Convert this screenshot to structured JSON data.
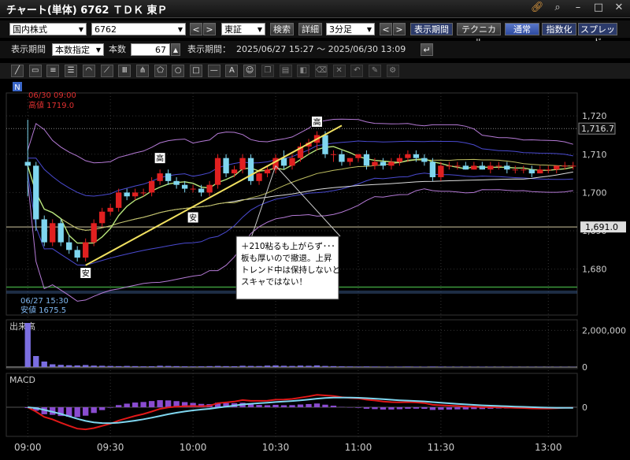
{
  "window": {
    "title": "チャート(単体) 6762 ＴＤＫ 東Ｐ"
  },
  "toolbar1": {
    "market": "国内株式",
    "code": "6762",
    "exchange": "東証",
    "search": "検索",
    "detail": "詳細",
    "interval": "3分足",
    "period_btn": "表示期間",
    "technical_btn": "テクニカル",
    "normal_btn": "通常",
    "index_btn": "指数化",
    "spread_btn": "スプレッド",
    "prev": "<",
    "next": ">"
  },
  "toolbar2": {
    "period_label": "表示期間",
    "mode": "本数指定",
    "count_label": "本数",
    "count": "67",
    "range_label": "表示期間：",
    "range": "2025/06/27 15:27 ～ 2025/06/30 13:09"
  },
  "tools": [
    "line-tool",
    "ruler-tool",
    "hline-tool",
    "channel-tool",
    "arc-tool",
    "fan-tool",
    "grid-tool",
    "pitchfork-tool",
    "pentagon-tool",
    "circle-tool",
    "rect-tool",
    "segment-tool",
    "text-tool",
    "icon-tool",
    "copy-tool",
    "paste-tool",
    "erase-tool",
    "delete-tool",
    "delete-all-tool",
    "undo-tool",
    "select-tool",
    "settings-tool"
  ],
  "chart_data": [
    {
      "type": "candlestick",
      "y_ticks": [
        1680,
        1690,
        1700,
        1710,
        1720
      ],
      "ylim": [
        1668,
        1726
      ],
      "x_ticks": [
        "09:00",
        "09:30",
        "10:00",
        "10:30",
        "11:00",
        "11:30",
        "13:00"
      ],
      "last_price": "1,716.7",
      "hline_value": "1,691.0",
      "high_label": "06/30 09:00",
      "high_value": "高値 1719.0",
      "low_label": "06/27 15:30",
      "low_value": "安値 1675.5",
      "marker_high": "高",
      "marker_low": "安",
      "note_lines": [
        "＋210粘るも上がらず･･･",
        "板も厚いので撤退。上昇",
        "トレンド中は保持しないと。",
        "スキャではない！"
      ],
      "n_marker": "N",
      "candles": [
        [
          1708,
          1719,
          1699,
          1707
        ],
        [
          1707,
          1708,
          1690,
          1693
        ],
        [
          1693,
          1694,
          1686,
          1687
        ],
        [
          1687,
          1693,
          1686,
          1692
        ],
        [
          1692,
          1693,
          1686,
          1687
        ],
        [
          1687,
          1689,
          1684,
          1685
        ],
        [
          1685,
          1686,
          1682,
          1683
        ],
        [
          1683,
          1688,
          1682,
          1687
        ],
        [
          1687,
          1693,
          1686,
          1692
        ],
        [
          1692,
          1696,
          1691,
          1695
        ],
        [
          1695,
          1697,
          1694,
          1696
        ],
        [
          1696,
          1701,
          1695,
          1700
        ],
        [
          1700,
          1701,
          1698,
          1699
        ],
        [
          1699,
          1701,
          1698,
          1700
        ],
        [
          1700,
          1701,
          1699,
          1700
        ],
        [
          1700,
          1704,
          1699,
          1703
        ],
        [
          1703,
          1706,
          1702,
          1705
        ],
        [
          1705,
          1706,
          1702,
          1703
        ],
        [
          1703,
          1704,
          1701,
          1702
        ],
        [
          1702,
          1703,
          1700,
          1701
        ],
        [
          1701,
          1702,
          1700,
          1701
        ],
        [
          1701,
          1702,
          1699,
          1700
        ],
        [
          1700,
          1703,
          1699,
          1702
        ],
        [
          1702,
          1710,
          1701,
          1709
        ],
        [
          1709,
          1710,
          1704,
          1705
        ],
        [
          1705,
          1707,
          1704,
          1706
        ],
        [
          1706,
          1710,
          1705,
          1709
        ],
        [
          1709,
          1710,
          1702,
          1703
        ],
        [
          1703,
          1706,
          1702,
          1705
        ],
        [
          1705,
          1707,
          1704,
          1706
        ],
        [
          1706,
          1710,
          1705,
          1709
        ],
        [
          1709,
          1711,
          1706,
          1707
        ],
        [
          1707,
          1710,
          1706,
          1709
        ],
        [
          1709,
          1713,
          1708,
          1712
        ],
        [
          1712,
          1714,
          1710,
          1713
        ],
        [
          1713,
          1716,
          1711,
          1715
        ],
        [
          1715,
          1716,
          1709,
          1710
        ],
        [
          1710,
          1711,
          1708,
          1710
        ],
        [
          1710,
          1711,
          1707,
          1708
        ],
        [
          1708,
          1709,
          1707,
          1709
        ],
        [
          1709,
          1710,
          1708,
          1710
        ],
        [
          1710,
          1711,
          1706,
          1707
        ],
        [
          1707,
          1709,
          1706,
          1708
        ],
        [
          1708,
          1709,
          1706,
          1707
        ],
        [
          1707,
          1709,
          1706,
          1708
        ],
        [
          1708,
          1710,
          1707,
          1709
        ],
        [
          1709,
          1711,
          1708,
          1710
        ],
        [
          1710,
          1711,
          1708,
          1709
        ],
        [
          1709,
          1710,
          1707,
          1708
        ],
        [
          1708,
          1709,
          1703,
          1704
        ],
        [
          1704,
          1708,
          1703,
          1707
        ],
        [
          1707,
          1708,
          1706,
          1707
        ],
        [
          1707,
          1708,
          1706,
          1707
        ],
        [
          1707,
          1708,
          1706,
          1706
        ],
        [
          1706,
          1708,
          1706,
          1707
        ],
        [
          1707,
          1708,
          1706,
          1706
        ],
        [
          1706,
          1708,
          1705,
          1707
        ],
        [
          1707,
          1708,
          1706,
          1707
        ],
        [
          1707,
          1708,
          1705,
          1706
        ],
        [
          1706,
          1707,
          1705,
          1706
        ],
        [
          1706,
          1707,
          1705,
          1706
        ],
        [
          1706,
          1707,
          1704,
          1705
        ],
        [
          1705,
          1707,
          1705,
          1706
        ],
        [
          1706,
          1707,
          1705,
          1706
        ],
        [
          1706,
          1707,
          1705,
          1707
        ],
        [
          1707,
          1708,
          1706,
          1707
        ],
        [
          1707,
          1708,
          1706,
          1707
        ]
      ]
    },
    {
      "type": "bar",
      "title": "出来高",
      "y_ticks": [
        "2,000,000",
        "0"
      ],
      "volume_max": 2400000,
      "values": [
        2400000,
        600000,
        300000,
        150000,
        120000,
        100000,
        90000,
        110000,
        80000,
        70000,
        60000,
        50000,
        60000,
        50000,
        40000,
        45000,
        70000,
        60000,
        50000,
        40000,
        35000,
        40000,
        50000,
        60000,
        50000,
        45000,
        70000,
        60000,
        55000,
        80000,
        90000,
        70000,
        60000,
        80000,
        70000,
        90000,
        60000,
        50000,
        40000,
        35000,
        30000,
        35000,
        30000,
        25000,
        20000,
        25000,
        30000,
        25000,
        20000,
        30000,
        25000,
        20000,
        20000,
        18000,
        15000,
        20000,
        18000,
        15000,
        16000,
        14000,
        12000,
        15000,
        14000,
        12000,
        15000,
        13000,
        12000
      ]
    },
    {
      "type": "line",
      "title": "MACD",
      "y_ticks": [
        "0"
      ]
    }
  ]
}
